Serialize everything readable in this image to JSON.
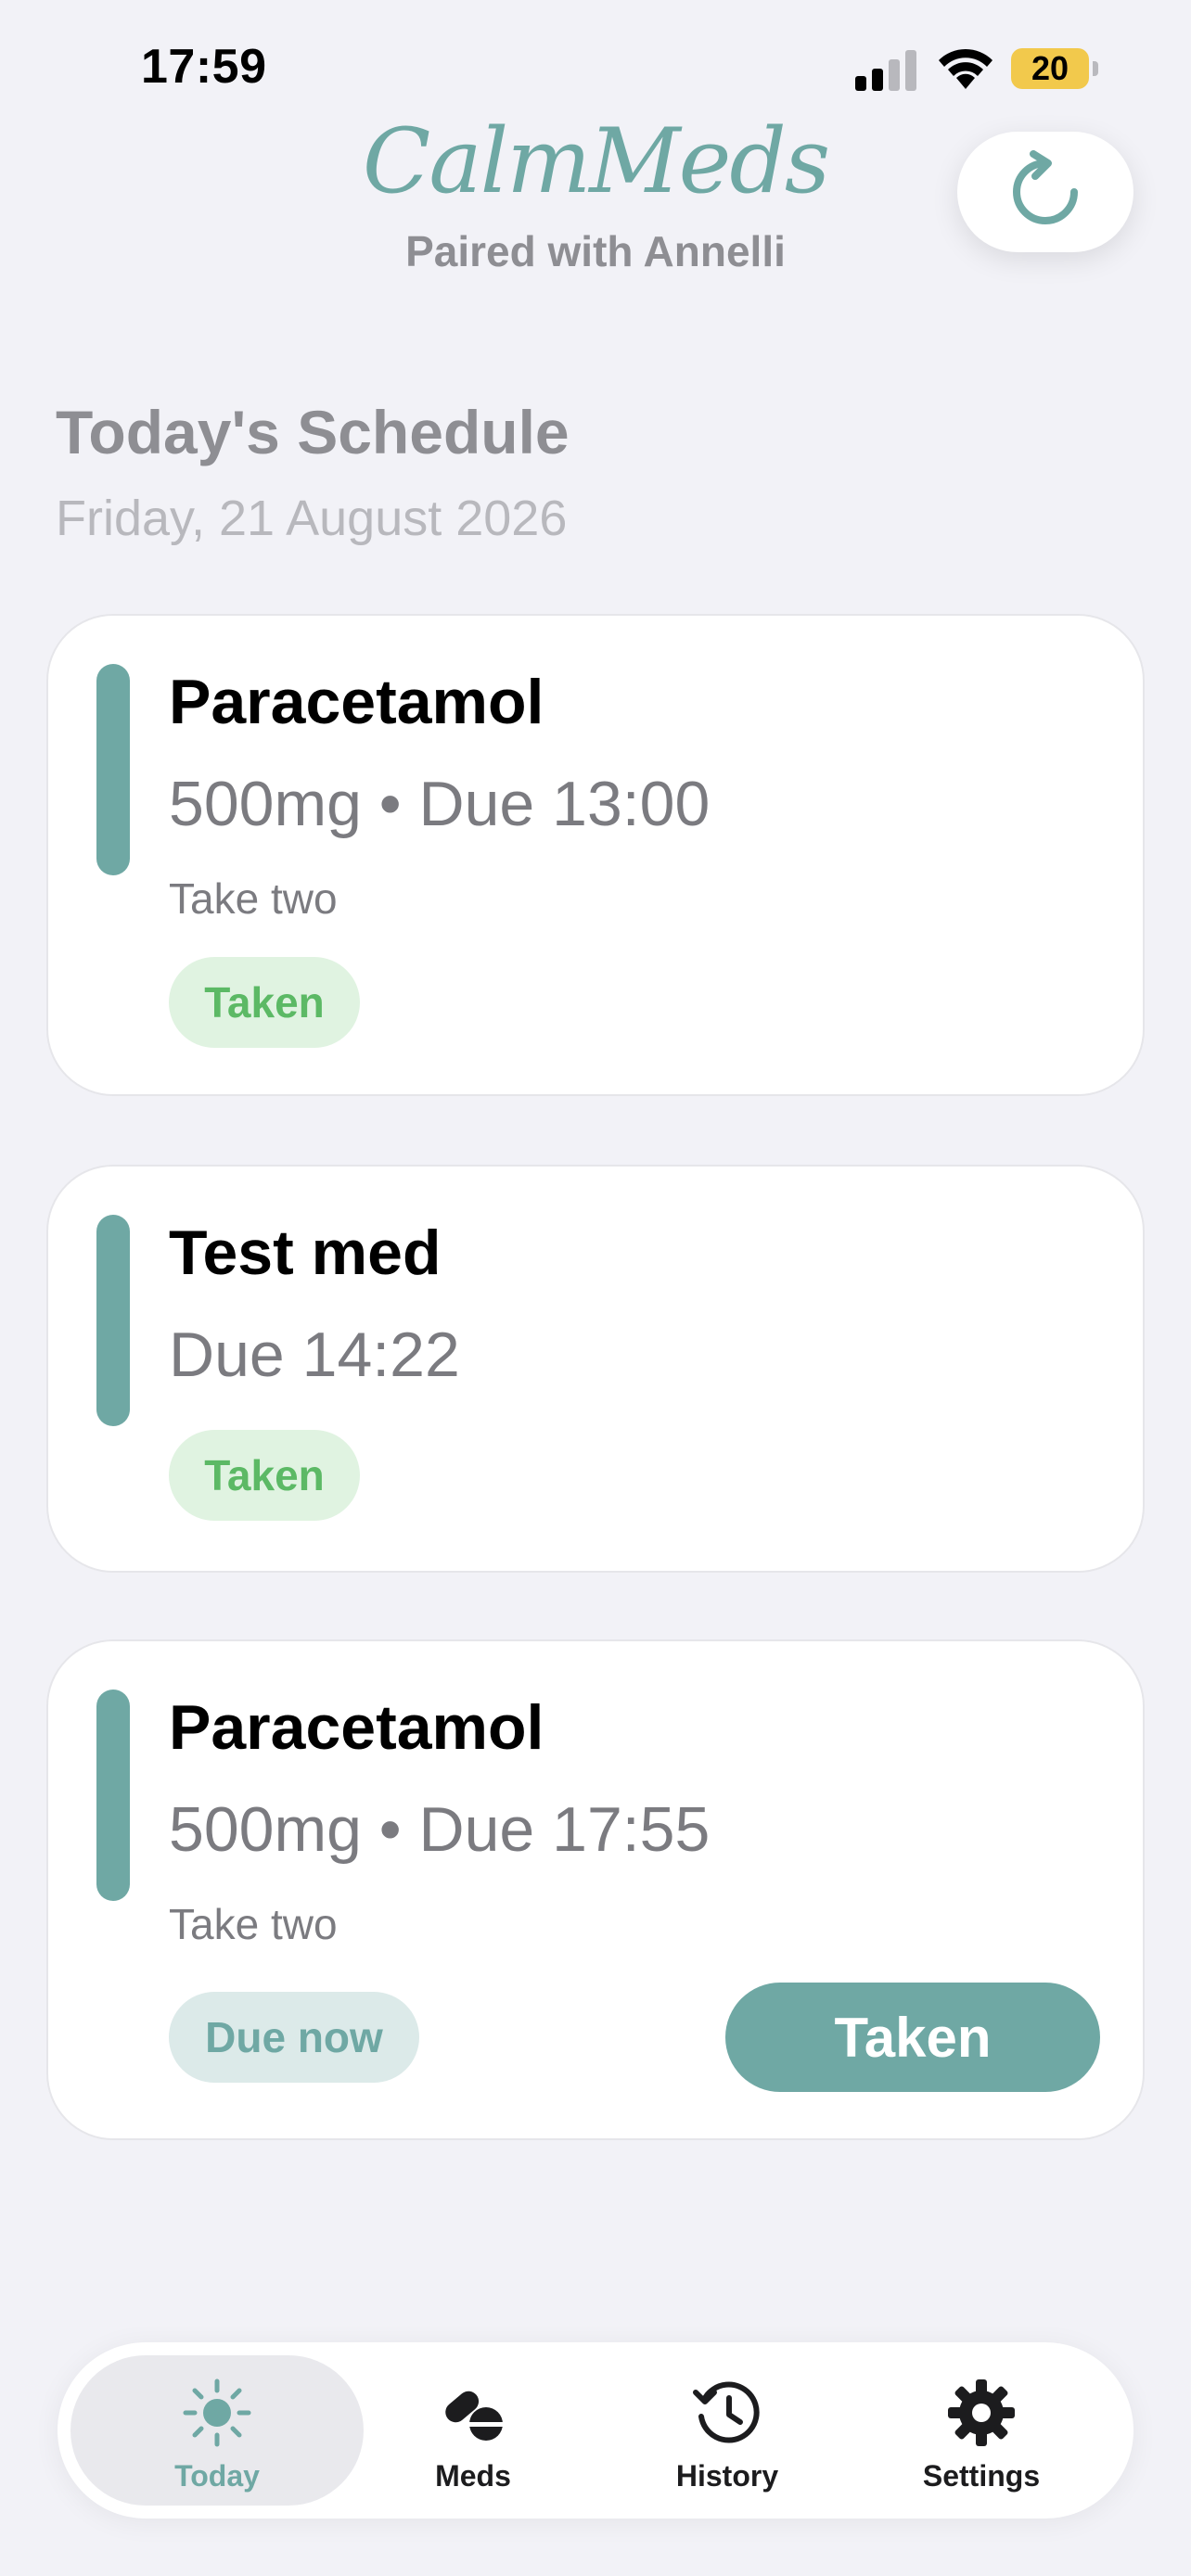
{
  "status_bar": {
    "time": "17:59",
    "battery": "20",
    "battery_color": "#f2c94c"
  },
  "header": {
    "app_title": "CalmMeds",
    "subtitle": "Paired with Annelli",
    "refresh_icon": "refresh-icon"
  },
  "schedule": {
    "title": "Today's Schedule",
    "date": "Friday, 21 August 2026",
    "items": [
      {
        "name": "Paracetamol",
        "dose": "500mg • Due 13:00",
        "note": "Take two",
        "status": "Taken"
      },
      {
        "name": "Test med",
        "dose": "Due 14:22",
        "status": "Taken"
      },
      {
        "name": "Paracetamol",
        "dose": "500mg • Due 17:55",
        "note": "Take two",
        "status": "Due now",
        "action": "Taken"
      }
    ]
  },
  "tabs": [
    {
      "label": "Today",
      "icon": "sun-icon",
      "active": true
    },
    {
      "label": "Meds",
      "icon": "pills-icon"
    },
    {
      "label": "History",
      "icon": "history-icon"
    },
    {
      "label": "Settings",
      "icon": "gear-icon"
    }
  ],
  "colors": {
    "accent": "#6fa8a4",
    "taken_text": "#5cb965",
    "taken_bg": "#e0f3e1",
    "background": "#f2f2f7"
  }
}
